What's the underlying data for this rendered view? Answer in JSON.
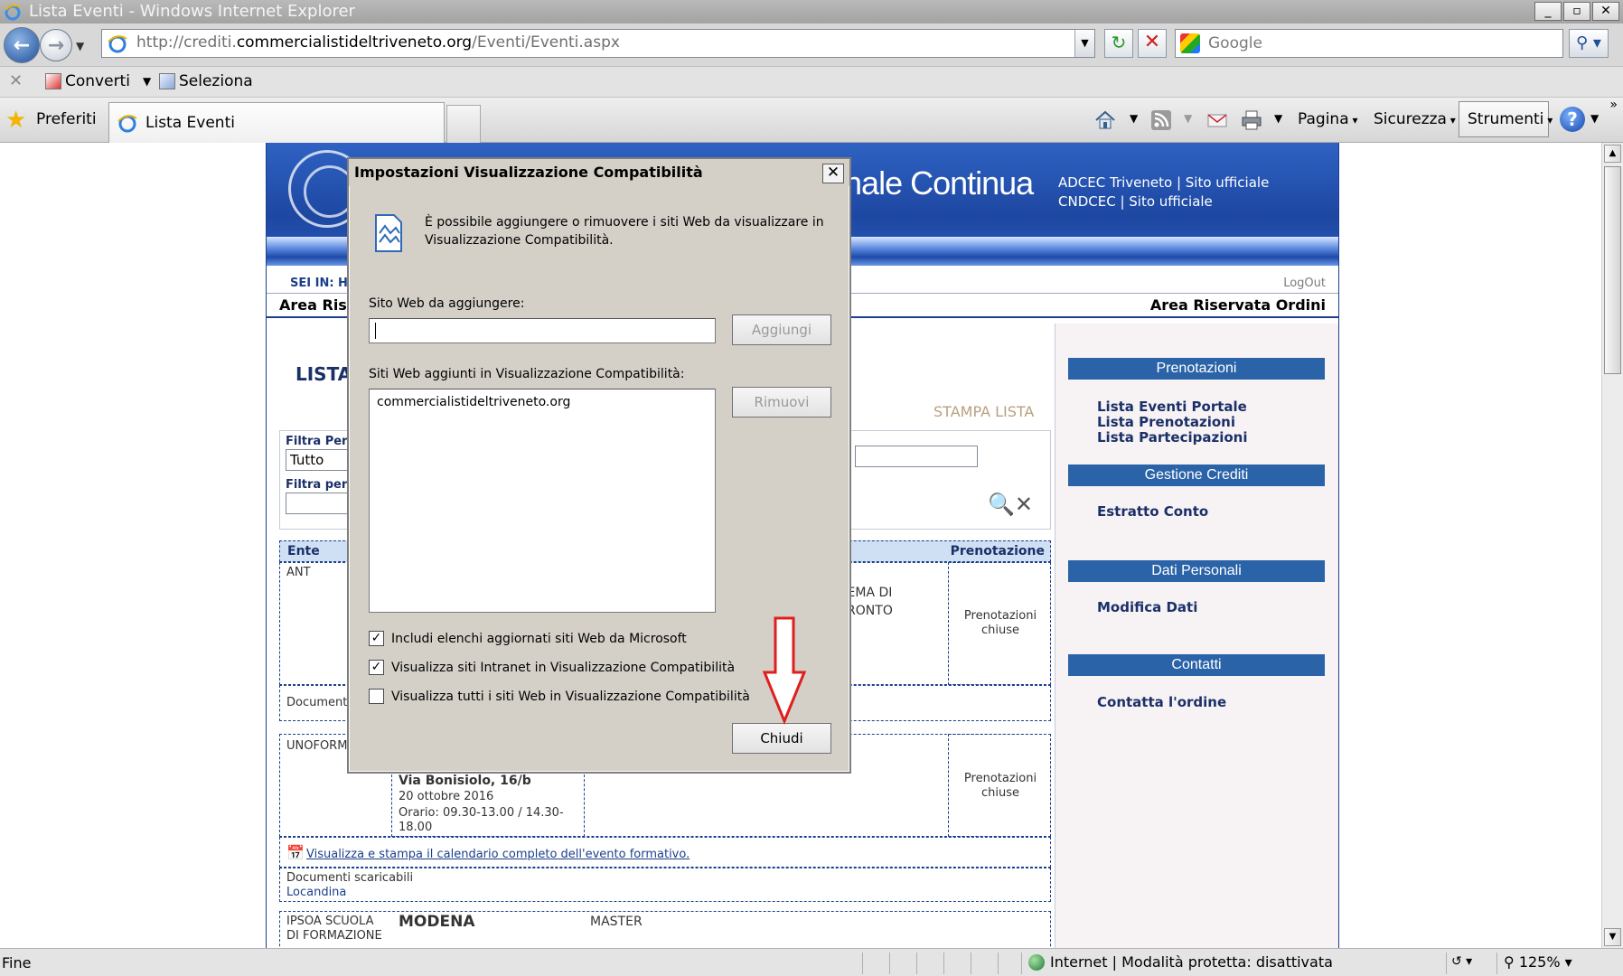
{
  "window": {
    "title": "Lista Eventi - Windows Internet Explorer",
    "min": "_",
    "max": "▫",
    "close": "✕"
  },
  "nav": {
    "url_prefix": "http://crediti.",
    "url_domain": "commercialistideltriveneto.org",
    "url_path": "/Eventi/Eventi.aspx",
    "search_placeholder": "Google"
  },
  "cmdbar": {
    "converti": "Converti",
    "seleziona": "Seleziona"
  },
  "favbar": {
    "preferiti": "Preferiti",
    "tab_label": "Lista Eventi",
    "menu": [
      "Pagina",
      "Sicurezza",
      "Strumenti"
    ]
  },
  "site": {
    "header_title": "onale Continua",
    "header_link1": "ADCEC Triveneto | Sito ufficiale",
    "header_link2": "CNDCEC | Sito ufficiale",
    "crumb": "SEI IN: HO",
    "logout": "LogOut",
    "area_left": "Area Rise",
    "area_right": "Area Riservata Ordini",
    "content_title": "LISTA",
    "stampa": "STAMPA LISTA",
    "filter_label1": "Filtra Per:",
    "filter_value1": "Tutto",
    "filter_label2": "Filtra per",
    "col_ente": "Ente",
    "col_prenotazione": "Prenotazione",
    "row1_ente": "ANT",
    "row1_text1": "TEMA DI",
    "row1_text2": "FRONTO",
    "row1_status": "Prenotazioni chiuse",
    "row1_docs": "Documenti",
    "row2_ente": "UNOFORMA",
    "row2_addr": "Via Bonisiolo, 16/b",
    "row2_date": "20 ottobre 2016",
    "row2_time": "Orario: 09.30-13.00 / 14.30-18.00",
    "row2_status": "Prenotazioni chiuse",
    "calendar_link": "Visualizza e stampa il calendario completo dell'evento formativo.",
    "docs_label": "Documenti scaricabili",
    "docs_link": "Locandina",
    "row3_ente1": "IPSOA SCUOLA",
    "row3_ente2": "DI FORMAZIONE",
    "row3_city": "MODENA",
    "row3_type": "MASTER"
  },
  "sidebar": {
    "prenotazioni": "Prenotazioni",
    "links1": [
      "Lista Eventi Portale",
      "Lista Prenotazioni",
      "Lista Partecipazioni"
    ],
    "gestione": "Gestione Crediti",
    "estratto": "Estratto Conto",
    "dati": "Dati Personali",
    "modifica": "Modifica Dati",
    "contatti": "Contatti",
    "contatta": "Contatta l'ordine"
  },
  "dialog": {
    "title": "Impostazioni Visualizzazione Compatibilità",
    "description": "È possibile aggiungere o rimuovere i siti Web da visualizzare in Visualizzazione Compatibilità.",
    "add_label": "Sito Web da aggiungere:",
    "add_value": "",
    "add_button": "Aggiungi",
    "list_label": "Siti Web aggiunti in Visualizzazione Compatibilità:",
    "list_items": [
      "commercialistideltriveneto.org"
    ],
    "remove_button": "Rimuovi",
    "checkboxes": [
      {
        "label": "Includi elenchi aggiornati siti Web da Microsoft",
        "checked": true
      },
      {
        "label": "Visualizza siti Intranet in Visualizzazione Compatibilità",
        "checked": true
      },
      {
        "label": "Visualizza tutti i siti Web in Visualizzazione Compatibilità",
        "checked": false
      }
    ],
    "close_button": "Chiudi"
  },
  "status": {
    "left": "Fine",
    "zone": "Internet | Modalità protetta: disattivata",
    "zoom": "125%"
  },
  "colors": {
    "brand_blue": "#1d47a1",
    "sidebar_header": "#2b63a8",
    "arrow_red": "#e01e1e"
  }
}
